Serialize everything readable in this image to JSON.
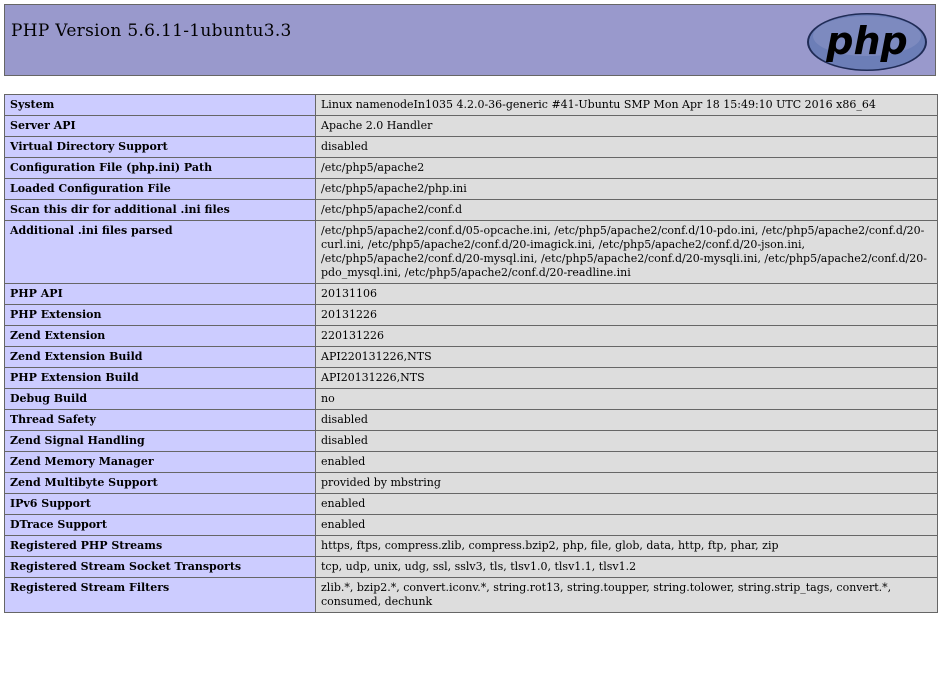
{
  "header": {
    "title": "PHP Version 5.6.11-1ubuntu3.3",
    "logo_text": "php"
  },
  "rows": [
    {
      "key": "System",
      "value": "Linux namenodeIn1035 4.2.0-36-generic #41-Ubuntu SMP Mon Apr 18 15:49:10 UTC 2016 x86_64"
    },
    {
      "key": "Server API",
      "value": "Apache 2.0 Handler"
    },
    {
      "key": "Virtual Directory Support",
      "value": "disabled"
    },
    {
      "key": "Configuration File (php.ini) Path",
      "value": "/etc/php5/apache2"
    },
    {
      "key": "Loaded Configuration File",
      "value": "/etc/php5/apache2/php.ini"
    },
    {
      "key": "Scan this dir for additional .ini files",
      "value": "/etc/php5/apache2/conf.d"
    },
    {
      "key": "Additional .ini files parsed",
      "value": "/etc/php5/apache2/conf.d/05-opcache.ini, /etc/php5/apache2/conf.d/10-pdo.ini, /etc/php5/apache2/conf.d/20-curl.ini, /etc/php5/apache2/conf.d/20-imagick.ini, /etc/php5/apache2/conf.d/20-json.ini, /etc/php5/apache2/conf.d/20-mysql.ini, /etc/php5/apache2/conf.d/20-mysqli.ini, /etc/php5/apache2/conf.d/20-pdo_mysql.ini, /etc/php5/apache2/conf.d/20-readline.ini"
    },
    {
      "key": "PHP API",
      "value": "20131106"
    },
    {
      "key": "PHP Extension",
      "value": "20131226"
    },
    {
      "key": "Zend Extension",
      "value": "220131226"
    },
    {
      "key": "Zend Extension Build",
      "value": "API220131226,NTS"
    },
    {
      "key": "PHP Extension Build",
      "value": "API20131226,NTS"
    },
    {
      "key": "Debug Build",
      "value": "no"
    },
    {
      "key": "Thread Safety",
      "value": "disabled"
    },
    {
      "key": "Zend Signal Handling",
      "value": "disabled"
    },
    {
      "key": "Zend Memory Manager",
      "value": "enabled"
    },
    {
      "key": "Zend Multibyte Support",
      "value": "provided by mbstring"
    },
    {
      "key": "IPv6 Support",
      "value": "enabled"
    },
    {
      "key": "DTrace Support",
      "value": "enabled"
    },
    {
      "key": "Registered PHP Streams",
      "value": "https, ftps, compress.zlib, compress.bzip2, php, file, glob, data, http, ftp, phar, zip"
    },
    {
      "key": "Registered Stream Socket Transports",
      "value": "tcp, udp, unix, udg, ssl, sslv3, tls, tlsv1.0, tlsv1.1, tlsv1.2"
    },
    {
      "key": "Registered Stream Filters",
      "value": "zlib.*, bzip2.*, convert.iconv.*, string.rot13, string.toupper, string.tolower, string.strip_tags, convert.*, consumed, dechunk"
    }
  ],
  "colors": {
    "header_bg": "#9999cc",
    "key_bg": "#ccccff",
    "value_bg": "#dddddd",
    "logo_fill": "#6c7eb7",
    "logo_text": "#000000"
  }
}
